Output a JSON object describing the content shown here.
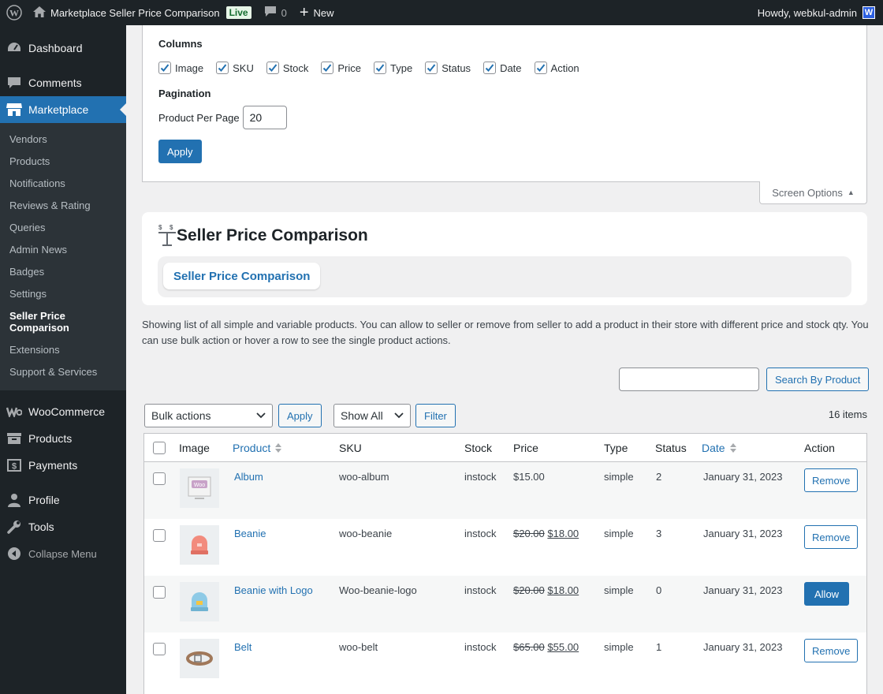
{
  "admin_bar": {
    "site_title": "Marketplace Seller Price Comparison",
    "live_badge": "Live",
    "comment_count": "0",
    "new_label": "New",
    "greeting": "Howdy, webkul-admin",
    "avatar_letter": "W"
  },
  "sidebar": {
    "dashboard": "Dashboard",
    "comments": "Comments",
    "marketplace": "Marketplace",
    "submenu": [
      "Vendors",
      "Products",
      "Notifications",
      "Reviews & Rating",
      "Queries",
      "Admin News",
      "Badges",
      "Settings",
      "Seller Price Comparison",
      "Extensions",
      "Support & Services"
    ],
    "woocommerce": "WooCommerce",
    "products": "Products",
    "payments": "Payments",
    "profile": "Profile",
    "tools": "Tools",
    "collapse": "Collapse Menu"
  },
  "screen_options": {
    "columns_heading": "Columns",
    "columns": [
      "Image",
      "SKU",
      "Stock",
      "Price",
      "Type",
      "Status",
      "Date",
      "Action"
    ],
    "pagination_heading": "Pagination",
    "per_page_label": "Product Per Page",
    "per_page_value": "20",
    "apply_label": "Apply",
    "toggle_label": "Screen Options"
  },
  "header": {
    "title": "Seller Price Comparison",
    "tab_label": "Seller Price Comparison"
  },
  "description": "Showing list of all simple and variable products. You can allow to seller or remove from seller to add a product in their store with different price and stock qty. You can use bulk action or hover a row to see the single product actions.",
  "search": {
    "value": "",
    "button_label": "Search By Product"
  },
  "tablenav": {
    "bulk_actions": "Bulk actions",
    "apply_label": "Apply",
    "show_all": "Show All",
    "filter_label": "Filter",
    "items_count": "16 items"
  },
  "table": {
    "headers": {
      "image": "Image",
      "product": "Product",
      "sku": "SKU",
      "stock": "Stock",
      "price": "Price",
      "type": "Type",
      "status": "Status",
      "date": "Date",
      "action": "Action"
    },
    "rows": [
      {
        "product": "Album",
        "sku": "woo-album",
        "stock": "instock",
        "price_old": "",
        "price": "$15.00",
        "type": "simple",
        "status": "2",
        "date": "January 31, 2023",
        "action": "Remove"
      },
      {
        "product": "Beanie",
        "sku": "woo-beanie",
        "stock": "instock",
        "price_old": "$20.00",
        "price": "$18.00",
        "type": "simple",
        "status": "3",
        "date": "January 31, 2023",
        "action": "Remove"
      },
      {
        "product": "Beanie with Logo",
        "sku": "Woo-beanie-logo",
        "stock": "instock",
        "price_old": "$20.00",
        "price": "$18.00",
        "type": "simple",
        "status": "0",
        "date": "January 31, 2023",
        "action": "Allow"
      },
      {
        "product": "Belt",
        "sku": "woo-belt",
        "stock": "instock",
        "price_old": "$65.00",
        "price": "$55.00",
        "type": "simple",
        "status": "1",
        "date": "January 31, 2023",
        "action": "Remove"
      }
    ]
  },
  "colors": {
    "admin_dark": "#1d2327",
    "accent": "#2271b1",
    "submenu_bg": "#2c3338"
  }
}
